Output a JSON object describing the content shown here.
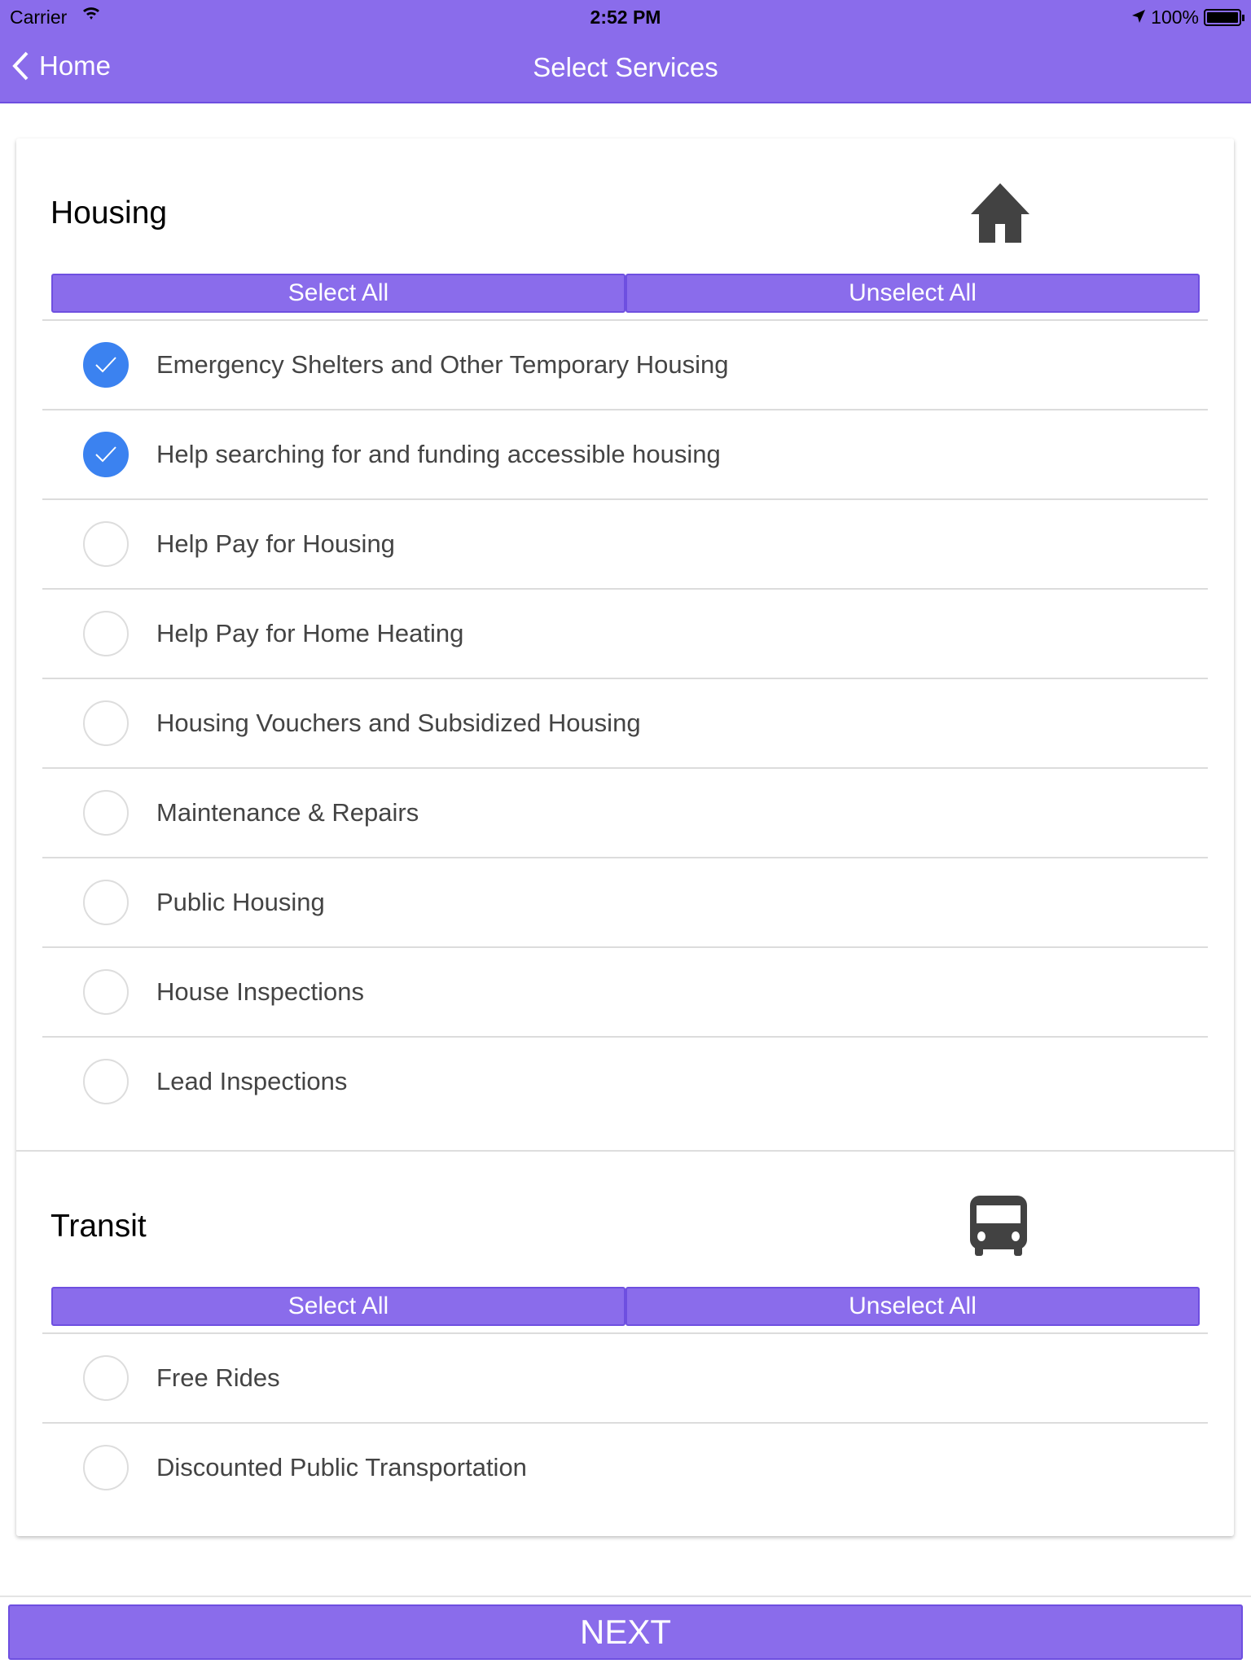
{
  "status_bar": {
    "carrier": "Carrier",
    "time": "2:52 PM",
    "battery": "100%",
    "battery_level": 1.0
  },
  "nav": {
    "back_label": "Home",
    "title": "Select Services"
  },
  "colors": {
    "accent": "#8a6ceb",
    "checked": "#3b82f0"
  },
  "sections": [
    {
      "title": "Housing",
      "icon": "house-icon",
      "select_all": "Select All",
      "unselect_all": "Unselect All",
      "items": [
        {
          "label": "Emergency Shelters and Other Temporary Housing",
          "checked": true
        },
        {
          "label": "Help searching for and funding accessible housing",
          "checked": true
        },
        {
          "label": "Help Pay for Housing",
          "checked": false
        },
        {
          "label": "Help Pay for Home Heating",
          "checked": false
        },
        {
          "label": "Housing Vouchers and Subsidized Housing",
          "checked": false
        },
        {
          "label": "Maintenance & Repairs",
          "checked": false
        },
        {
          "label": "Public Housing",
          "checked": false
        },
        {
          "label": "House Inspections",
          "checked": false
        },
        {
          "label": "Lead Inspections",
          "checked": false
        }
      ]
    },
    {
      "title": "Transit",
      "icon": "bus-icon",
      "select_all": "Select All",
      "unselect_all": "Unselect All",
      "items": [
        {
          "label": "Free Rides",
          "checked": false
        },
        {
          "label": "Discounted Public Transportation",
          "checked": false
        }
      ]
    }
  ],
  "footer": {
    "next_label": "NEXT"
  }
}
